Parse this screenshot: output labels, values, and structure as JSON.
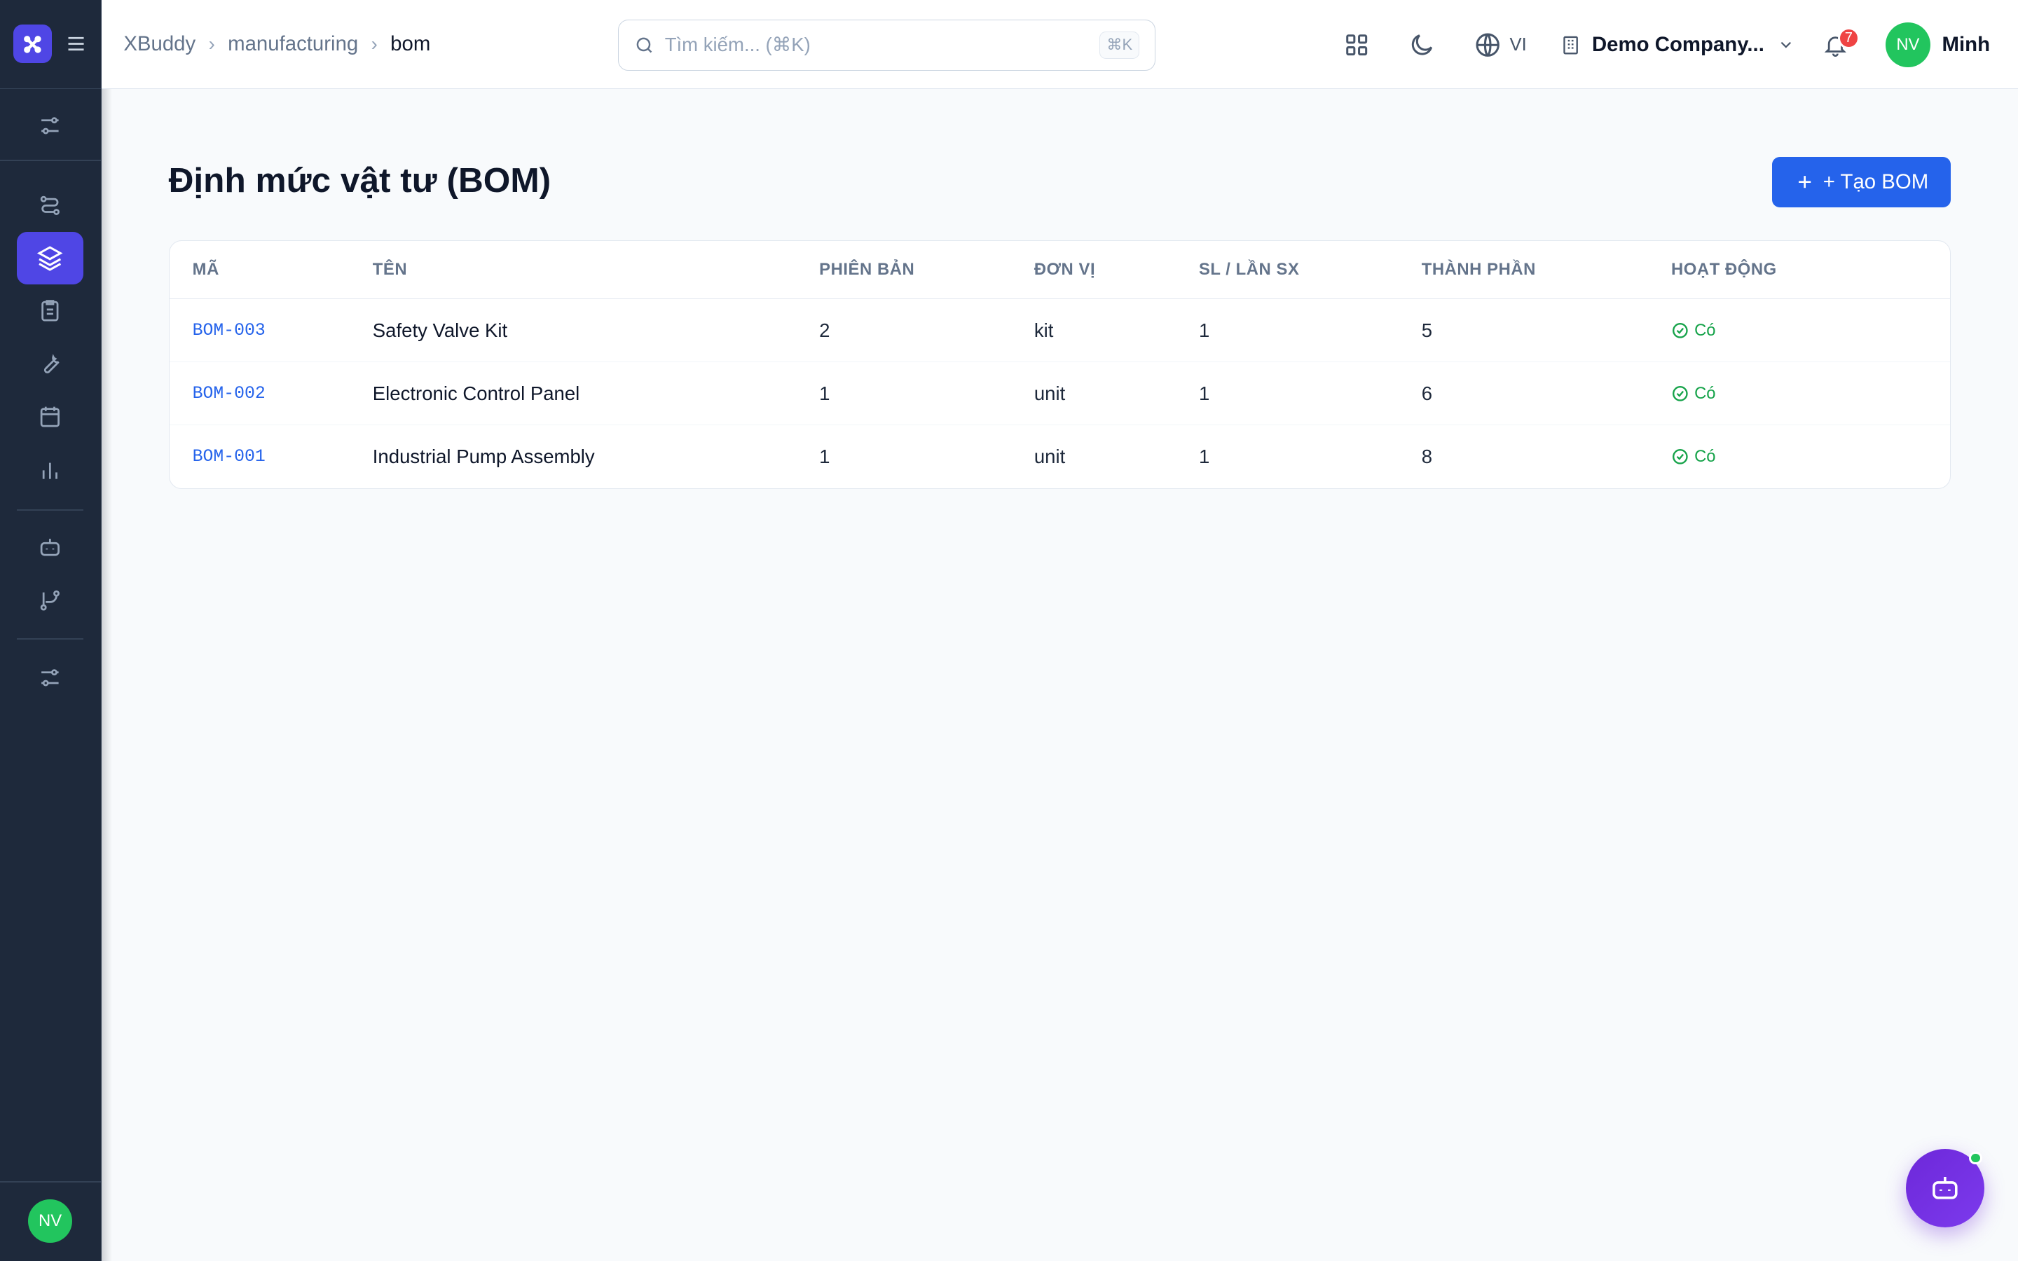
{
  "breadcrumb": [
    "XBuddy",
    "manufacturing",
    "bom"
  ],
  "search": {
    "placeholder": "Tìm kiếm... (⌘K)",
    "shortcut": "⌘K"
  },
  "header": {
    "language": "VI",
    "company": "Demo Company...",
    "notifications_count": "7",
    "user_initials": "NV",
    "user_name": "Minh"
  },
  "sidebar": {
    "user_initials": "NV",
    "items": [
      {
        "icon": "sliders-icon"
      },
      {
        "icon": "routes-icon"
      },
      {
        "icon": "layers-icon",
        "active": true
      },
      {
        "icon": "clipboard-icon"
      },
      {
        "icon": "wrench-icon"
      },
      {
        "icon": "calendar-icon"
      },
      {
        "icon": "bar-chart-icon"
      },
      {
        "icon": "bot-icon"
      },
      {
        "icon": "git-branch-icon"
      },
      {
        "icon": "settings-sliders-icon"
      }
    ]
  },
  "page": {
    "title": "Định mức vật tư (BOM)",
    "create_button": "+ Tạo BOM"
  },
  "table": {
    "columns": [
      "MÃ",
      "TÊN",
      "PHIÊN BẢN",
      "ĐƠN VỊ",
      "SL / LẦN SX",
      "THÀNH PHẦN",
      "HOẠT ĐỘNG"
    ],
    "rows": [
      {
        "code": "BOM-003",
        "name": "Safety Valve Kit",
        "version": "2",
        "unit": "kit",
        "qty": "1",
        "components": "5",
        "active": "Có"
      },
      {
        "code": "BOM-002",
        "name": "Electronic Control Panel",
        "version": "1",
        "unit": "unit",
        "qty": "1",
        "components": "6",
        "active": "Có"
      },
      {
        "code": "BOM-001",
        "name": "Industrial Pump Assembly",
        "version": "1",
        "unit": "unit",
        "qty": "1",
        "components": "8",
        "active": "Có"
      }
    ]
  },
  "colors": {
    "accent": "#4f46e5",
    "primary": "#2563eb",
    "success": "#16a34a",
    "sidebar": "#1e293b"
  }
}
